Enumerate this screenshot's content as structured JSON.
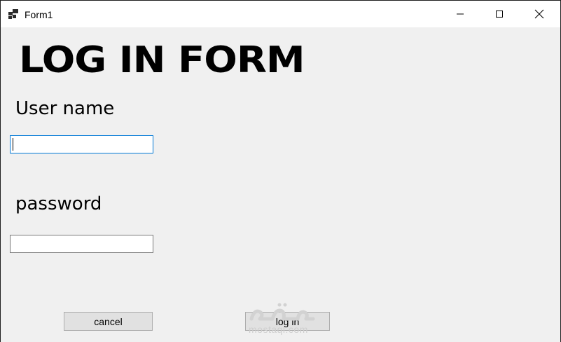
{
  "window": {
    "title": "Form1"
  },
  "titlebar_buttons": {
    "minimize_icon": "minimize-icon",
    "maximize_icon": "maximize-icon",
    "close_icon": "close-icon"
  },
  "form": {
    "heading": "LOG IN FORM",
    "username_label": "User name",
    "username_value": "",
    "password_label": "password",
    "password_value": "",
    "cancel_label": "cancel",
    "login_label": "log in"
  },
  "watermark": {
    "text": "mostaql.com"
  },
  "colors": {
    "background": "#f0f0f0",
    "focus_border": "#0078d7",
    "button_face": "#e1e1e1"
  }
}
